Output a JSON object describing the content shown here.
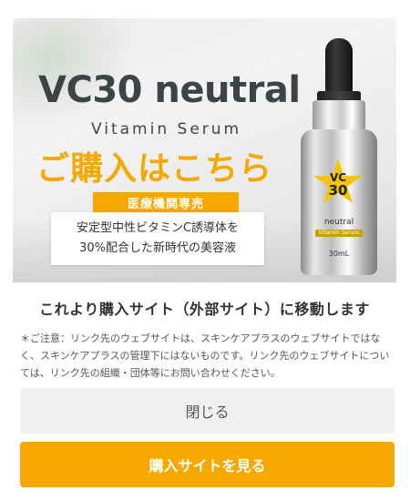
{
  "banner": {
    "product_name": "VC30 neutral",
    "product_subtitle": "Vitamin Serum",
    "cta_heading": "ご購入はこちら",
    "badge": "医療機関専売",
    "description_lines": [
      "安定型中性ビタミンC誘導体を",
      "30%配合した新時代の美容液"
    ],
    "bottle": {
      "star_top": "VC",
      "star_bottom": "30",
      "label_name": "neutral",
      "label_sub": "Vitamin Serum",
      "volume": "30mL"
    },
    "accent_color": "#f6a800"
  },
  "notice": {
    "title": "これより購入サイト（外部サイト）に移動します",
    "body": "＊ご注意：リンク先のウェブサイトは、スキンケアプラスのウェブサイトではなく、スキンケアプラスの管理下にはないものです。リンク先のウェブサイトについては、リンク先の組織・団体等にお問い合わせください。"
  },
  "buttons": {
    "close_label": "閉じる",
    "buy_label": "購入サイトを見る"
  }
}
